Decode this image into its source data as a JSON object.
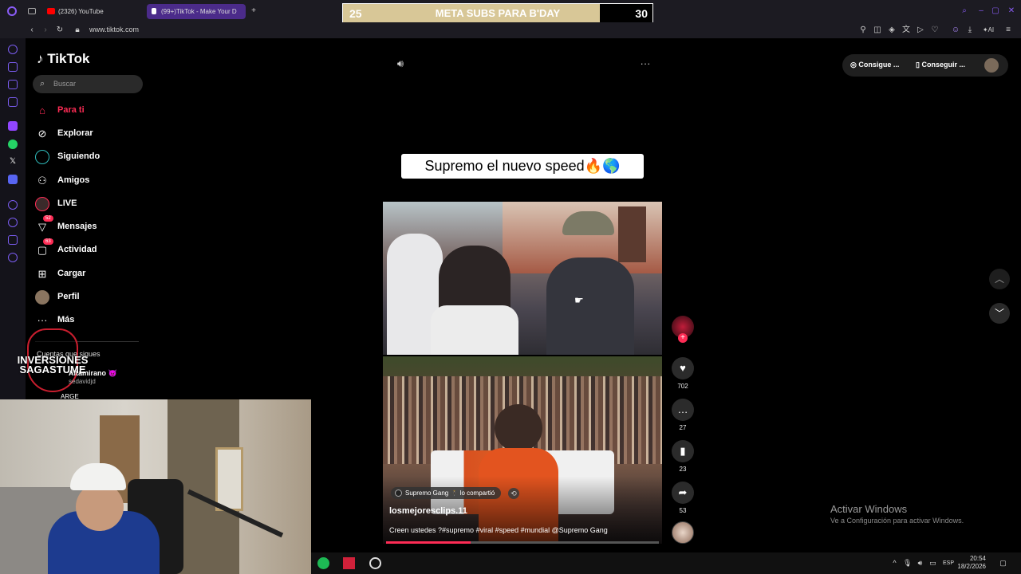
{
  "browser": {
    "tabs": [
      {
        "label": "(2326) YouTube",
        "color": "#ff0000"
      },
      {
        "label": "(99+)TikTok - Make Your D",
        "color": "#ffffff"
      }
    ],
    "url": "www.tiktok.com"
  },
  "overlay": {
    "current": "25",
    "title": "META SUBS PARA B'DAY",
    "goal": "30",
    "progress": 0.83
  },
  "sidebar": {
    "logo": "TikTok",
    "search_placeholder": "Buscar",
    "items": [
      {
        "label": "Para ti",
        "icon": "home-icon",
        "active": true
      },
      {
        "label": "Explorar",
        "icon": "compass-icon"
      },
      {
        "label": "Siguiendo",
        "icon": "following-icon"
      },
      {
        "label": "Amigos",
        "icon": "friends-icon"
      },
      {
        "label": "LIVE",
        "icon": "live-icon"
      },
      {
        "label": "Mensajes",
        "icon": "messages-icon",
        "badge": "52"
      },
      {
        "label": "Actividad",
        "icon": "activity-icon",
        "badge": "63"
      },
      {
        "label": "Cargar",
        "icon": "upload-icon"
      },
      {
        "label": "Perfil",
        "icon": "profile-icon"
      },
      {
        "label": "Más",
        "icon": "more-icon"
      }
    ],
    "following_header": "Cuentas que sigues",
    "following": [
      "Altamirano 😈",
      "sedavidjd",
      "ARGE"
    ],
    "logo_overlay_text": "INVERSIONES SAGASTUME"
  },
  "video": {
    "caption": "Supremo el nuevo speed🔥🌎",
    "shared_by": "Supremo Gang 🕴 lo compartió",
    "author": "losmejoresclips.11",
    "description": "Creen ustedes ?#supremo #viral #speed #mundial @Supremo Gang",
    "progress": 0.31
  },
  "actions": {
    "likes": "702",
    "comments": "27",
    "saves": "23",
    "shares": "53"
  },
  "topbar": {
    "coins_label": "Consigue ...",
    "app_label": "Conseguir ..."
  },
  "windows": {
    "activate_title": "Activar Windows",
    "activate_sub": "Ve a Configuración para activar Windows.",
    "lang": "ESP",
    "time": "20:54",
    "date": "18/2/2026"
  }
}
